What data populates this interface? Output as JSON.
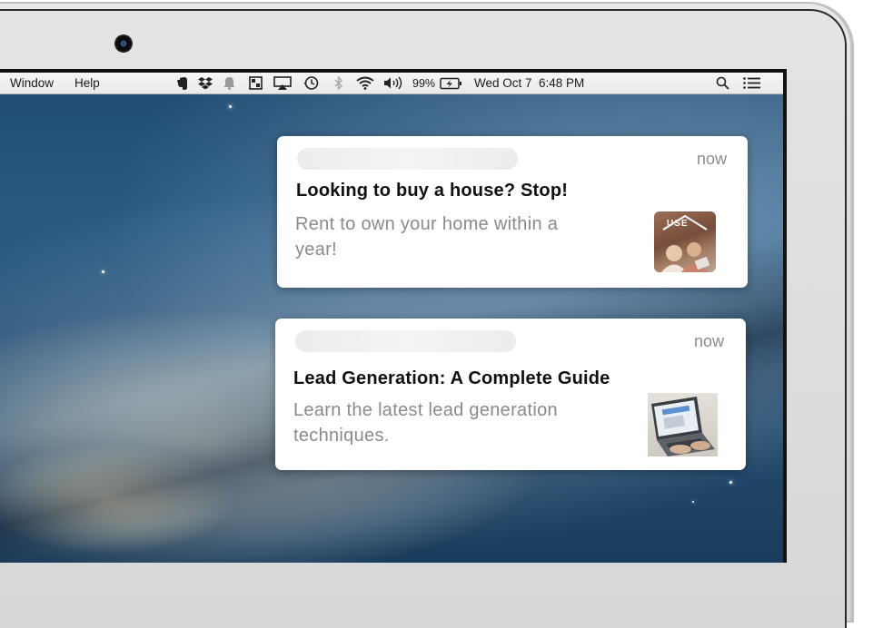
{
  "menubar": {
    "menus": [
      "Window",
      "Help"
    ],
    "status_icons": [
      "evernote-icon",
      "dropbox-icon",
      "bell-icon",
      "window-icon",
      "airplay-icon",
      "time-machine-icon",
      "bluetooth-icon",
      "wifi-icon",
      "volume-icon"
    ],
    "battery_percent": "99%",
    "datetime": "Wed Oct 7  6:48 PM",
    "right_icons": [
      "search-icon",
      "notification-center-icon"
    ]
  },
  "notifications": [
    {
      "time": "now",
      "title": "Looking to buy a house? Stop!",
      "body": "Rent to own your home within a year!",
      "thumb_icon": "house-family-thumbnail",
      "thumb_logo": "USE"
    },
    {
      "time": "now",
      "title": "Lead Generation: A Complete Guide",
      "body": "Learn the latest lead generation techniques.",
      "thumb_icon": "laptop-typing-thumbnail"
    }
  ],
  "colors": {
    "wallpaper": "#254f74",
    "notification_bg": "#ffffff",
    "title": "#101010",
    "body": "#8a8a8a"
  }
}
